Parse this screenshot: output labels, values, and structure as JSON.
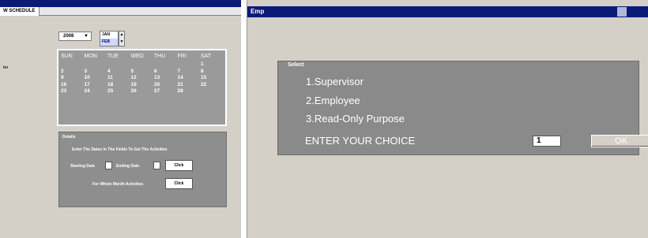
{
  "left_window": {
    "tab_label": "W SCHEDULE",
    "side_label": "ter",
    "year": {
      "value": "2008",
      "arrow": "▼"
    },
    "months": [
      "JAN",
      "FEB"
    ],
    "month_scroll": {
      "up": "▲",
      "down": "▼"
    },
    "calendar": {
      "day_headers": [
        "SUN",
        "MON",
        "TUE",
        "WED",
        "THU",
        "FRI",
        "SAT"
      ],
      "rows": [
        [
          "",
          "",
          "",
          "",
          "",
          "",
          "1"
        ],
        [
          "2",
          "3",
          "4",
          "5",
          "6",
          "7",
          "8"
        ],
        [
          "9",
          "10",
          "11",
          "12",
          "13",
          "14",
          "15"
        ],
        [
          "16",
          "17",
          "18",
          "19",
          "20",
          "21",
          "22"
        ],
        [
          "23",
          "24",
          "25",
          "26",
          "27",
          "28",
          ""
        ]
      ]
    },
    "details": {
      "legend": "Details",
      "instruction": "Enter The Dates In The Fields To Get The Activities",
      "starting_date_label": "Starting Date",
      "ending_date_label": "Ending Date",
      "ok_label": "Click",
      "whole_month_label": "For Whole Month Activities",
      "whole_month_ok_label": "Click"
    }
  },
  "right_window": {
    "title": "Emp",
    "panel_legend": "Select",
    "options": [
      "1.Supervisor",
      "2.Employee",
      "3.Read-Only Purpose"
    ],
    "choice_label": "ENTER YOUR CHOICE",
    "choice_value": "1",
    "ok_label": "OK"
  }
}
